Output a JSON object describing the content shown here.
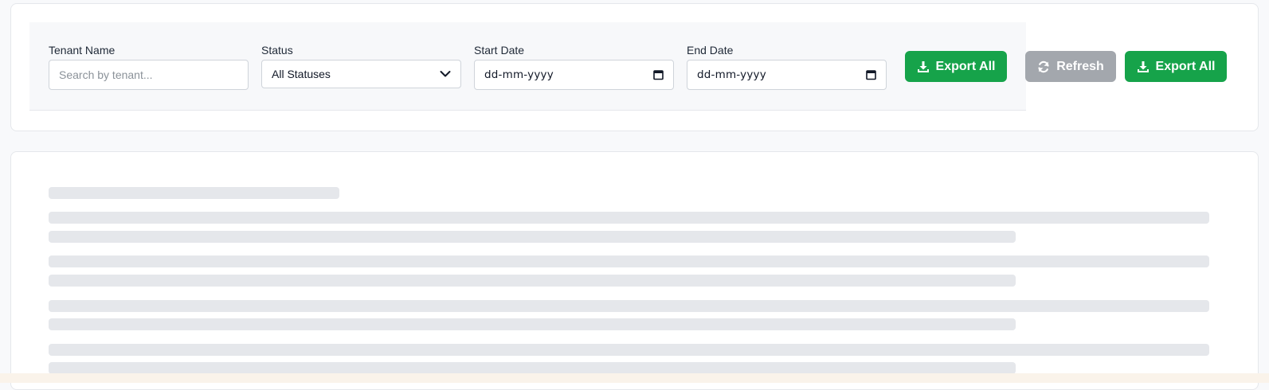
{
  "filters": {
    "tenant": {
      "label": "Tenant Name",
      "placeholder": "Search by tenant..."
    },
    "status": {
      "label": "Status",
      "value": "All Statuses",
      "icon": "chevron-down-icon"
    },
    "start_date": {
      "label": "Start Date",
      "value": "dd-mm-yyyy",
      "icon": "calendar-icon"
    },
    "end_date": {
      "label": "End Date",
      "value": "dd-mm-yyyy",
      "icon": "calendar-icon"
    }
  },
  "actions": {
    "export_all_inline": {
      "label": "Export All",
      "icon": "download-icon",
      "color": "#16a34a"
    },
    "refresh": {
      "label": "Refresh",
      "icon": "refresh-icon",
      "color": "#a3a7ad",
      "disabled": true
    },
    "export_all": {
      "label": "Export All",
      "icon": "download-icon",
      "color": "#16a34a"
    }
  },
  "content": {
    "state": "loading",
    "skeleton_color": "#e5e7eb"
  }
}
